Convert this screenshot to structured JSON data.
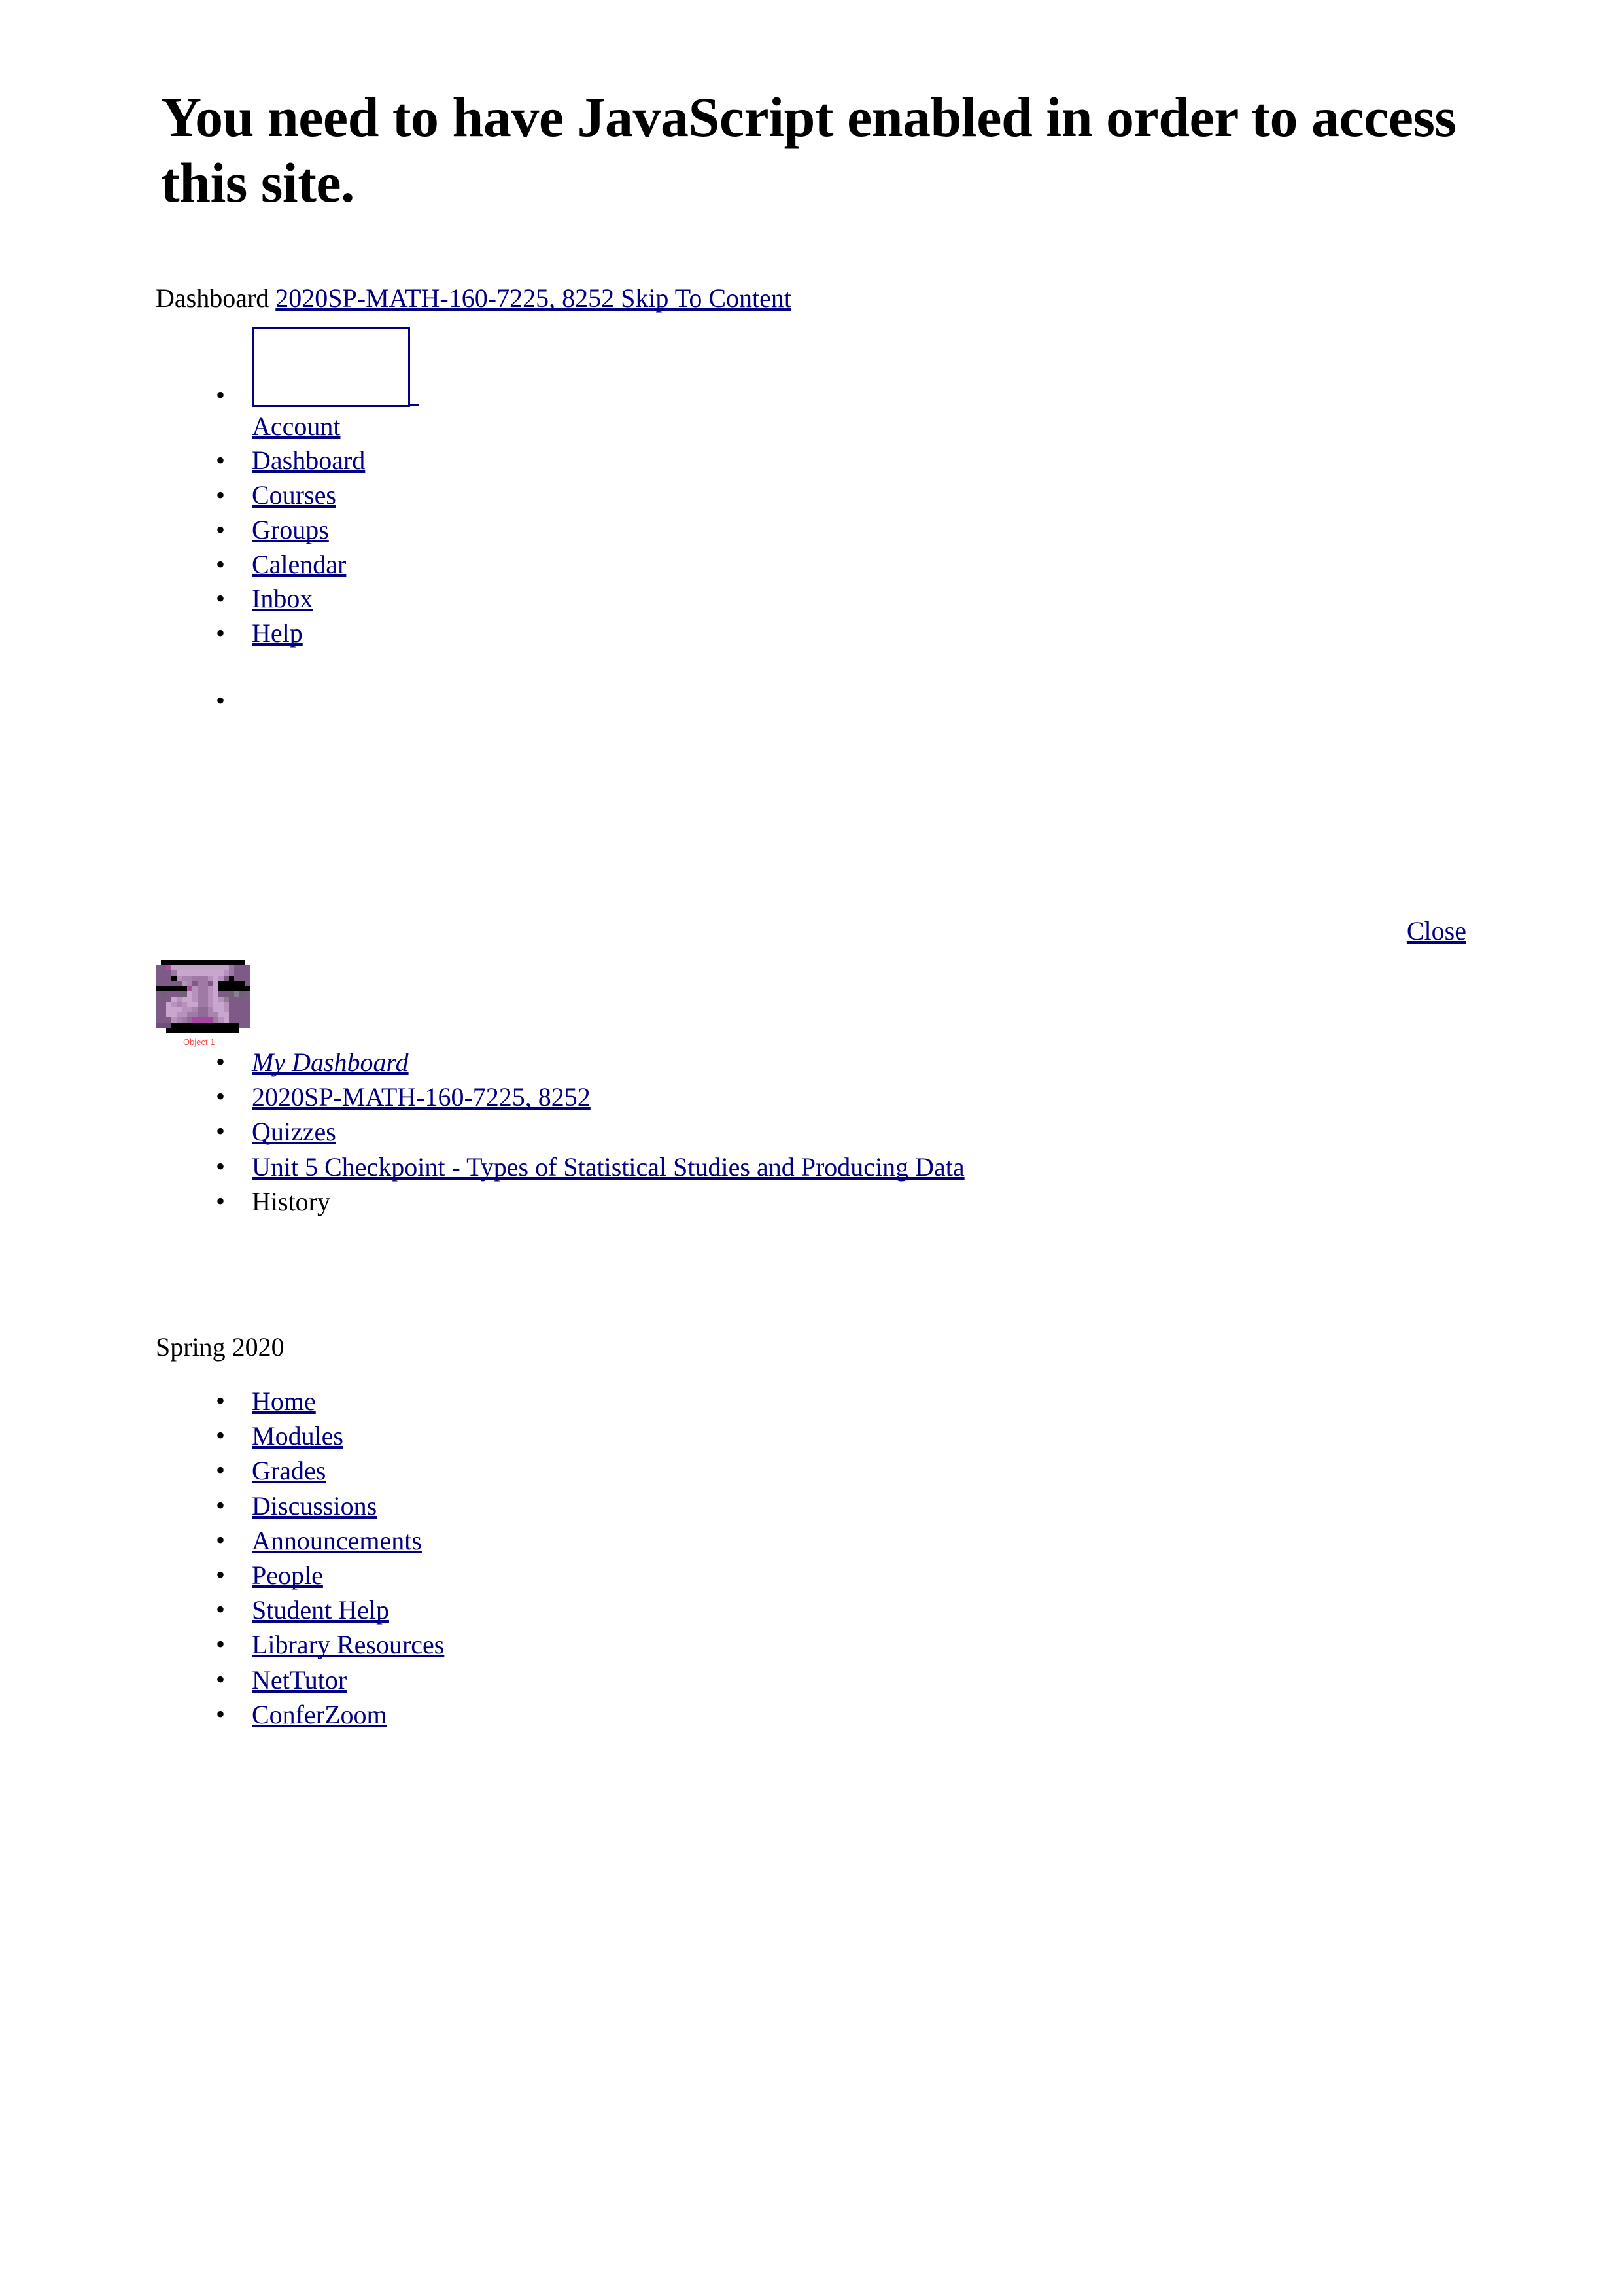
{
  "page": {
    "js_warning": "You need to have JavaScript enabled in order to access this site.",
    "background_color": "#ffffff",
    "link_color": "#000080",
    "text_color": "#000000"
  },
  "topbar": {
    "dashboard_label": "Dashboard",
    "course_skip_link": "2020SP-MATH-160-7225, 8252 Skip To Content"
  },
  "global_nav": {
    "avatar_icon": "broken-image-placeholder-icon",
    "items": [
      {
        "label": "Account "
      },
      {
        "label": "Dashboard"
      },
      {
        "label": "Courses "
      },
      {
        "label": "Groups "
      },
      {
        "label": "Calendar "
      },
      {
        "label": "Inbox "
      },
      {
        "label": "Help "
      }
    ],
    "empty_item": ""
  },
  "tray": {
    "close_label": "Close"
  },
  "course_card": {
    "image_alt": "Object 1",
    "image_description": "pixelated purple course card thumbnail"
  },
  "breadcrumb": {
    "items": [
      {
        "label": "My Dashboard ",
        "style": "italic-link",
        "is_link": true
      },
      {
        "label": "2020SP-MATH-160-7225, 8252",
        "style": "link",
        "is_link": true
      },
      {
        "label": "Quizzes",
        "style": "link",
        "is_link": true
      },
      {
        "label": "Unit 5 Checkpoint - Types of Statistical Studies and Producing Data",
        "style": "link",
        "is_link": true
      },
      {
        "label": "History",
        "style": "plain",
        "is_link": false
      }
    ]
  },
  "term": {
    "label": "Spring 2020"
  },
  "course_nav": {
    "items": [
      {
        "label": "Home"
      },
      {
        "label": "Modules"
      },
      {
        "label": "Grades"
      },
      {
        "label": "Discussions"
      },
      {
        "label": "Announcements"
      },
      {
        "label": "People"
      },
      {
        "label": "Student Help"
      },
      {
        "label": "Library Resources"
      },
      {
        "label": "NetTutor"
      },
      {
        "label": "ConferZoom"
      }
    ]
  }
}
